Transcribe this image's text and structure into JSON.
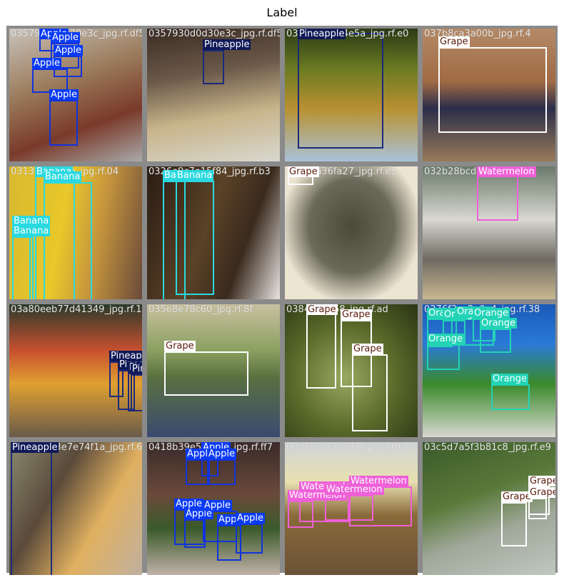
{
  "title": "Label",
  "colors": {
    "Apple": {
      "bg": "#0b3bf3",
      "fg": "#ffffff",
      "box": "#1133dd"
    },
    "Pineapple": {
      "bg": "#101a58",
      "fg": "#ffffff",
      "box": "#1b2a7a"
    },
    "Grape": {
      "bg": "#ffffff",
      "fg": "#5a1a0a",
      "box": "#ffffff"
    },
    "Banana": {
      "bg": "#2ad9e0",
      "fg": "#ffffff",
      "box": "#2ad9e0"
    },
    "Watermelon": {
      "bg": "#ee60d8",
      "fg": "#ffffff",
      "box": "#ee60d8"
    },
    "Orange": {
      "bg": "#22d3b6",
      "fg": "#ffffff",
      "box": "#22d3b6"
    }
  },
  "tiles": [
    {
      "filename": "0357930d0d30e3c_jpg.rf.df5376f9e5d2",
      "bg": "linear-gradient(160deg,#c9c3bb 0%,#9a7a5a 40%,#7a3a2a 70%,#a9a9a9 100%)",
      "annotations": [
        {
          "label": "Apple"
        },
        {
          "label": "Apple"
        },
        {
          "label": "Apple"
        },
        {
          "label": "Apple"
        },
        {
          "label": "Apple"
        }
      ]
    },
    {
      "filename": "0357930d0d30e3c_jpg.rf.df5376f9e5d2",
      "bg": "linear-gradient(170deg,#3a2a22 0%,#6b5a4a 35%,#c8b48a 65%,#d8d8cf 100%)",
      "annotations": [
        {
          "label": "Pineapple"
        }
      ]
    },
    {
      "filename": "035e0335bf4e5a_jpg.rf.e0",
      "bg": "linear-gradient(180deg,#2a3a16 0%,#6a7a22 30%,#b89030 60%,#a9c2d8 100%)",
      "annotations": [
        {
          "label": "Pineapple"
        }
      ]
    },
    {
      "filename": "037b8ca3a00b_jpg.rf.4",
      "bg": "linear-gradient(180deg,#b48a66 0%,#a06a44 40%,#2a2e4a 60%,#9a7a5a 100%)",
      "annotations": [
        {
          "label": "Grape"
        }
      ]
    },
    {
      "filename": "0313f5f5cb5b_jpg.rf.04",
      "bg": "linear-gradient(100deg,#d9b830 0%,#e8c82a 40%,#c5953d 65%,#6a4a3a 100%)",
      "annotations": [
        {
          "label": "Banana"
        },
        {
          "label": "Banana"
        },
        {
          "label": "Banana"
        },
        {
          "label": "Banana"
        }
      ]
    },
    {
      "filename": "0326e9c7e15f84_jpg.rf.b3",
      "bg": "linear-gradient(110deg,#2a1c14 0%,#5a4226 45%,#3a2a1e 70%,#e8e4e0 100%)",
      "annotations": [
        {
          "label": "Banana"
        },
        {
          "label": "Banana"
        }
      ]
    },
    {
      "filename": "034d7a36fa27_jpg.rf.e5",
      "bg": "radial-gradient(ellipse at 50% 45%,#4a4a3a 0%,#6a6a5a 45%,#ede4d2 75%)",
      "annotations": [
        {
          "label": "Grape"
        }
      ]
    },
    {
      "filename": "032b28bcd93a_jpg.rf.ec",
      "bg": "linear-gradient(180deg,#6a7a6a 0%,#d8d8d0 40%,#6e6a62 70%,#c9b890 100%)",
      "annotations": [
        {
          "label": "Watermelon"
        }
      ]
    },
    {
      "filename": "03a80eeb77d41349_jpg.rf.1",
      "bg": "linear-gradient(180deg,#2a3a2a 0%,#c85030 35%,#e0a030 60%,#6a5a4a 100%)",
      "annotations": [
        {
          "label": "Pineapple"
        },
        {
          "label": "Pineapple"
        },
        {
          "label": "Pineapple"
        },
        {
          "label": "Pineapple"
        }
      ]
    },
    {
      "filename": "035e8e78c60_jpg.rf.8f",
      "bg": "linear-gradient(180deg,#c9c0a0 0%,#8aa060 35%,#5a7040 55%,#3a4a70 100%)",
      "annotations": [
        {
          "label": "Grape"
        }
      ]
    },
    {
      "filename": "0384b51b58_jpg.rf.ad",
      "bg": "radial-gradient(ellipse at 45% 55%,#9aa860 0%,#5a6a2a 50%,#2a3414 100%)",
      "annotations": [
        {
          "label": "Grape"
        },
        {
          "label": "Grape"
        },
        {
          "label": "Grape"
        }
      ]
    },
    {
      "filename": "0376f3ec2a0e4_jpg.rf.38",
      "bg": "linear-gradient(180deg,#1a5ab8 0%,#2a7ad8 30%,#3a8a2a 60%,#d8d8d0 100%)",
      "annotations": [
        {
          "label": "Orange"
        },
        {
          "label": "Orange"
        },
        {
          "label": "Orange"
        },
        {
          "label": "Orange"
        },
        {
          "label": "Orange"
        },
        {
          "label": "Orange"
        },
        {
          "label": "Orange"
        }
      ]
    },
    {
      "filename": "03b5b2f93e7e74f1a_jpg.rf.620",
      "bg": "linear-gradient(120deg,#8a8a70 0%,#5a4a3a 35%,#e0b060 65%,#c0b0a0 100%)",
      "annotations": [
        {
          "label": "Pineapple"
        }
      ]
    },
    {
      "filename": "0418b39e5c5c5a_jpg.rf.ff7",
      "bg": "linear-gradient(180deg,#3a2a2a 0%,#6a4a3a 40%,#3a5a2a 65%,#c0b0a8 100%)",
      "annotations": [
        {
          "label": "Apple"
        },
        {
          "label": "Apple"
        },
        {
          "label": "Apple"
        },
        {
          "label": "Apple"
        },
        {
          "label": "Apple"
        },
        {
          "label": "Apple"
        },
        {
          "label": "Apple"
        },
        {
          "label": "Apple"
        }
      ]
    },
    {
      "filename": "03d5b8f2a5897_jpg.rf.f90",
      "bg": "linear-gradient(180deg,#d0d4d8 0%,#e8e0b0 30%,#8a6a3a 55%,#6a5236 100%)",
      "annotations": [
        {
          "label": "Watermelon"
        },
        {
          "label": "Watermelon"
        },
        {
          "label": "Watermelon"
        },
        {
          "label": "Watermelon"
        }
      ]
    },
    {
      "filename": "03c5d7a5f3b81c8_jpg.rf.e9",
      "bg": "linear-gradient(160deg,#3a5a2a 0%,#5a7a3a 40%,#a0a89a 65%,#c0c8c0 100%)",
      "annotations": [
        {
          "label": "Grape"
        },
        {
          "label": "Grape"
        },
        {
          "label": "Grape"
        }
      ]
    }
  ]
}
